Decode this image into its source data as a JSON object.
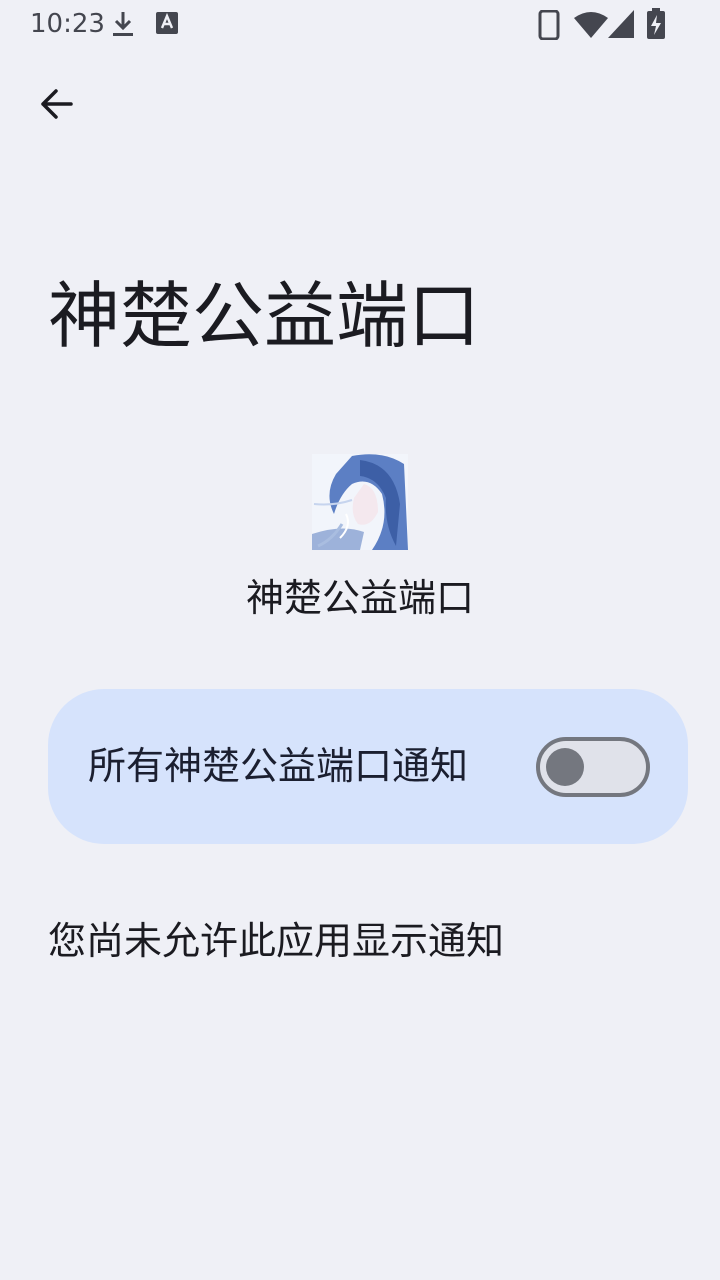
{
  "status_bar": {
    "time": "10:23",
    "icons": [
      "download-icon",
      "text-a-icon",
      "phone-icon",
      "wifi-icon",
      "cell-signal-icon",
      "battery-charging-icon"
    ]
  },
  "header": {
    "back_icon": "arrow-back-icon",
    "title": "神楚公益端口"
  },
  "app": {
    "name": "神楚公益端口"
  },
  "notification_toggle": {
    "label": "所有神楚公益端口通知",
    "enabled": false
  },
  "notice": "您尚未允许此应用显示通知",
  "colors": {
    "background": "#eff0f6",
    "card": "#d6e3fc",
    "switch_outline": "#74777f"
  }
}
